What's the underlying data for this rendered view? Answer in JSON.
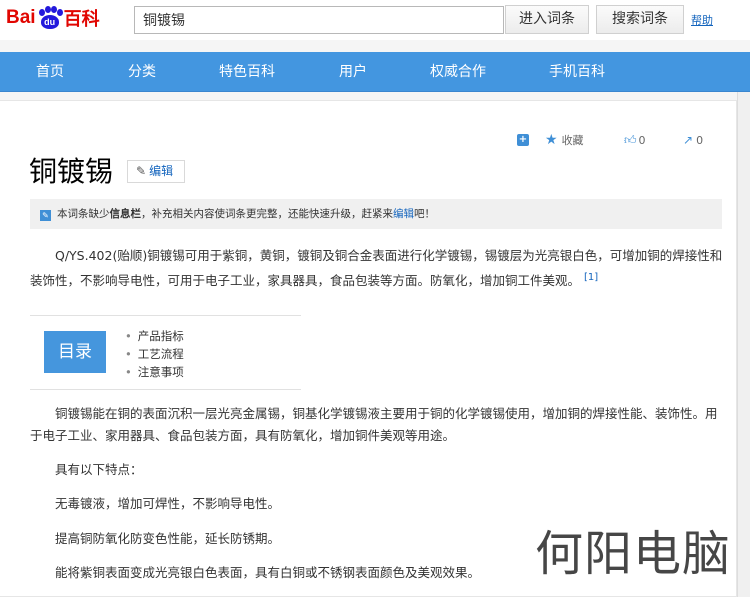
{
  "header": {
    "logo_part1": "Bai",
    "logo_paw": "du",
    "logo_part2": "百科",
    "search_value": "铜镀锡",
    "enter_button": "进入词条",
    "search_button": "搜索词条",
    "help_link": "帮助"
  },
  "nav": {
    "items": [
      "首页",
      "分类",
      "特色百科",
      "用户",
      "权威合作",
      "手机百科"
    ]
  },
  "toolbar": {
    "collect_label": "收藏",
    "like_count": "0",
    "share_count": "0"
  },
  "article": {
    "title": "铜镀锡",
    "edit_label": "编辑",
    "notice": {
      "prefix": "本词条缺少",
      "bold": "信息栏",
      "middle": "，补充相关内容使词条更完整，还能快速升级，赶紧来",
      "link": "编辑",
      "suffix": "吧！"
    },
    "intro": "Q/YS.402(贻顺)铜镀锡可用于紫铜，黄铜，镀铜及铜合金表面进行化学镀锡，锡镀层为光亮银白色，可增加铜的焊接性和装饰性，不影响导电性，可用于电子工业，家具器具，食品包装等方面。防氧化，增加铜工件美观。",
    "intro_cite": "[1]",
    "toc": {
      "head": "目录",
      "items": [
        "产品指标",
        "工艺流程",
        "注意事项"
      ]
    },
    "body_para1": "铜镀锡能在铜的表面沉积一层光亮金属锡，铜基化学镀锡液主要用于铜的化学镀锡使用，增加铜的焊接性能、装饰性。用于电子工业、家用器具、食品包装方面，具有防氧化，增加铜件美观等用途。",
    "features_intro": "具有以下特点：",
    "feature1": "无毒镀液，增加可焊性，不影响导电性。",
    "feature2": "提高铜防氧化防变色性能，延长防锈期。",
    "feature3": "能将紫铜表面变成光亮银白色表面，具有白铜或不锈钢表面颜色及美观效果。"
  },
  "watermark": "何阳电脑",
  "colors": {
    "nav_bg": "#4396e0",
    "brand_red": "#e10601",
    "brand_blue": "#2319dc",
    "link": "#1364bd",
    "toc_head": "#4596dd"
  }
}
